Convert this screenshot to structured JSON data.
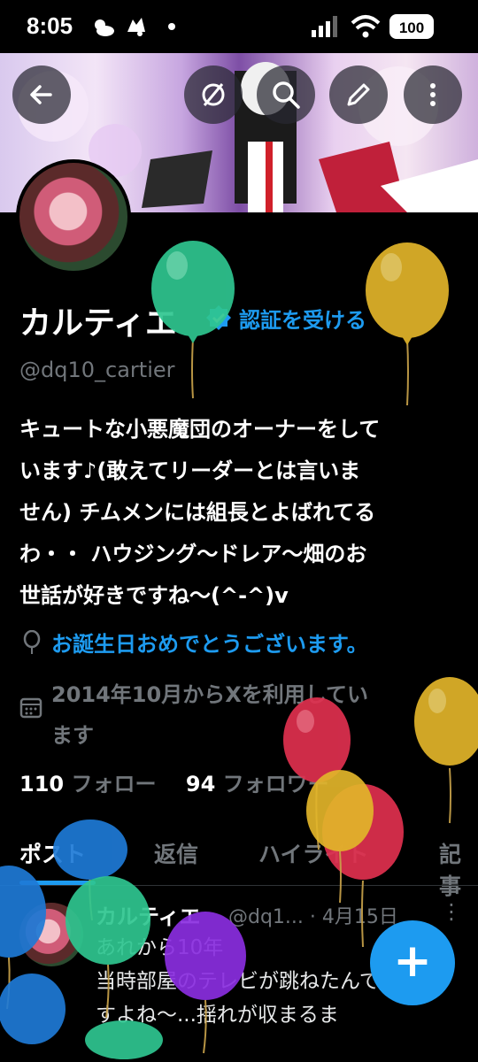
{
  "status_bar": {
    "time": "8:05",
    "battery": "100"
  },
  "header_buttons": [
    "back-icon",
    "not-following-icon",
    "search-icon",
    "edit-icon",
    "more-icon"
  ],
  "profile": {
    "name": "カルティエ",
    "verify_link": "認証を受ける",
    "handle": "@dq10_cartier",
    "bio_lines": [
      "キュートな小悪魔団のオーナーをして",
      "います♪(敢えてリーダーとは言いま",
      "せん) チムメンには組長とよばれてる",
      "わ・・ ハウジング〜ドレア〜畑のお",
      "世話が好きですね〜(^-^)v"
    ],
    "birthday": "お誕生日おめでとうございます。",
    "joined_lines": [
      "2014年10月からXを利用してい",
      "ます"
    ],
    "following_count": "110",
    "following_label": "フォロー",
    "followers_count": "94",
    "followers_label": "フォロワー"
  },
  "tabs": [
    "ポスト",
    "返信",
    "ハイライト",
    "記事"
  ],
  "tweet": {
    "name": "カルティエ",
    "meta": "@dq1... · 4月15日",
    "lines": [
      "あれから10年",
      "当時部屋のテレビが跳ねたんで",
      "すよね〜...揺れが収まるま"
    ]
  },
  "fab_label": "+",
  "colors": {
    "accent": "#1d9bf0",
    "background": "#000000",
    "muted": "#71767b"
  }
}
